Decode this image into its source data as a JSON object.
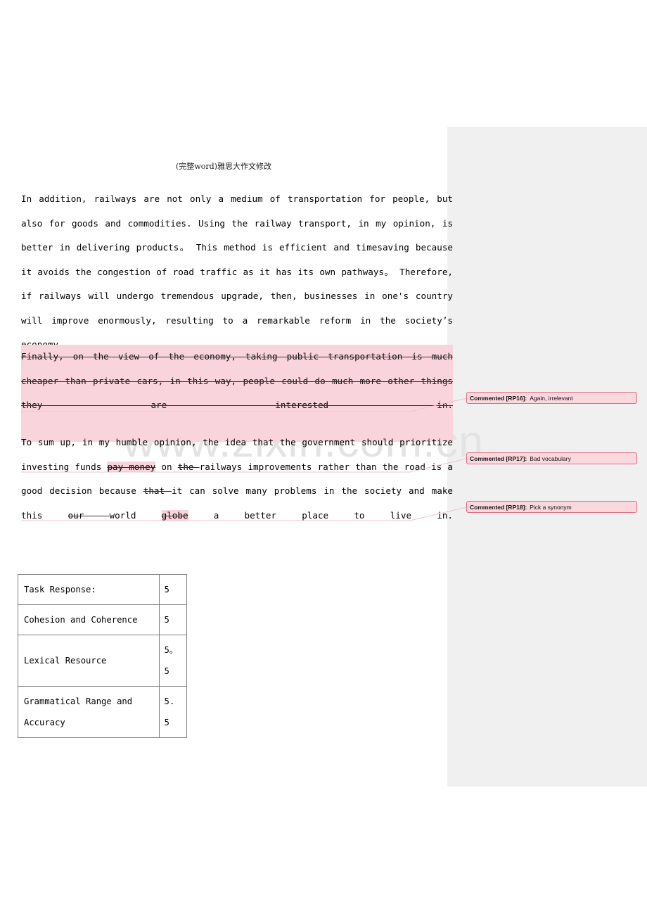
{
  "document": {
    "header": "(完整word)雅思大作文修改",
    "watermark": "www.zixin.com.cn"
  },
  "paragraphs": {
    "p1": {
      "runs": [
        "In addition, railways are not only a medium of transportation for people, but also for goods and commodities. Using the railway transport, in my opinion, is better in delivering products。 This method is efficient and timesaving because it avoids the congestion of road traffic as it has its own pathways。 Therefore, if railways will undergo tremendous upgrade, then, businesses in one's country will improve enormously, resulting to a remarkable reform in the society’s economy."
      ]
    },
    "p_deleted": {
      "text": "Finally, on the view of the economy, taking public transportation is much cheaper than private cars, in this way, people could do much more other things they are interested in."
    },
    "p3": {
      "seg_1": "To sum up, in my humble opinion, the idea that the government should prioritize investing funds ",
      "seg_del_1": "pay money",
      "seg_2": " on ",
      "seg_del_2": "the ",
      "seg_3": "railways improvements rather than the road is a good decision because ",
      "seg_del_3": "that ",
      "seg_4": "it can solve many problems in the society and make this ",
      "seg_del_4": "our ",
      "seg_5": "world ",
      "seg_del_5": "globe",
      "seg_6": " a better place to live in."
    }
  },
  "comments": [
    {
      "id": "comment-rp16",
      "tag": "Commented [RP16]:",
      "body": "Again, irrelevant"
    },
    {
      "id": "comment-rp17",
      "tag": "Commented [RP17]:",
      "body": "Bad vocabulary"
    },
    {
      "id": "comment-rp18",
      "tag": "Commented [RP18]:",
      "body": "Pick a synonym"
    }
  ],
  "score_table": {
    "rows": [
      {
        "criterion": "Task Response:",
        "criterion_right": "",
        "score_line_1": "5",
        "score_line_2": ""
      },
      {
        "criterion": "Cohesion and Coherence",
        "criterion_right": "",
        "score_line_1": "5",
        "score_line_2": ""
      },
      {
        "criterion": "Lexical Resource",
        "criterion_right": "",
        "score_line_1": "5。",
        "score_line_2": "5"
      },
      {
        "criterion": "Grammatical      Range      and",
        "criterion_right": "Accuracy",
        "score_line_1": "5.",
        "score_line_2": "5"
      }
    ]
  },
  "colors": {
    "highlight_pink": "#fad4dc",
    "comment_bg": "#fbd7de",
    "comment_border": "#e06f86",
    "margin_band": "#f0f0f0",
    "watermark": "#e3e3e3"
  }
}
